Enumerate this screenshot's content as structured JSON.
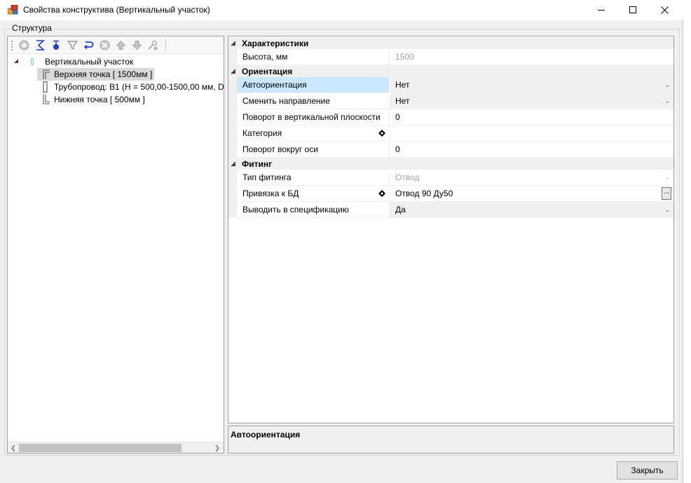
{
  "window": {
    "title": "Свойства конструктива (Вертикальный участок)"
  },
  "group": {
    "label": "Структура"
  },
  "toolbar": {
    "icons": [
      "add-circle-icon",
      "sigma-icon",
      "sort-icon",
      "filter-icon",
      "undo-arrow-icon",
      "remove-circle-icon",
      "move-up-icon",
      "move-down-icon",
      "tools-icon"
    ]
  },
  "tree": {
    "root": {
      "label": "Вертикальный участок",
      "expanded": true
    },
    "children": [
      {
        "label": "Верхняя точка [ 1500мм ]",
        "selected": true,
        "icon": "top-point-icon"
      },
      {
        "label": "Трубопровод: В1 (H = 500,00-1500,00 мм, D",
        "selected": false,
        "icon": "pipe-segment-icon"
      },
      {
        "label": "Нижняя точка [ 500мм ]",
        "selected": false,
        "icon": "bottom-point-icon"
      }
    ]
  },
  "properties": {
    "categories": [
      {
        "name": "Характеристики",
        "rows": [
          {
            "name": "Высота, мм",
            "value": "1500",
            "readonly": true
          }
        ]
      },
      {
        "name": "Ориентация",
        "rows": [
          {
            "name": "Автоориентация",
            "value": "Нет",
            "dropdown": true,
            "selected": true
          },
          {
            "name": "Сменить направление",
            "value": "Нет",
            "dropdown": true
          },
          {
            "name": "Поворот в вертикальной плоскости",
            "value": "0"
          },
          {
            "name": "Категория",
            "value": "",
            "marker": true
          },
          {
            "name": "Поворот вокруг оси",
            "value": "0"
          }
        ]
      },
      {
        "name": "Фитинг",
        "rows": [
          {
            "name": "Тип фитинга",
            "value": "Отвод",
            "readonly": true,
            "dropdown": true
          },
          {
            "name": "Привязка к БД",
            "value": "Отвод 90 Ду50",
            "marker": true,
            "ellipsis": true,
            "ellipsis_label": "..."
          },
          {
            "name": "Выводить в спецификацию",
            "value": "Да",
            "dropdown": true
          }
        ]
      }
    ]
  },
  "description": {
    "title": "Автоориентация"
  },
  "buttons": {
    "close_label": "Закрыть"
  },
  "colors": {
    "selection": "#cce8ff",
    "tree_selection": "#d9d9d9",
    "accent_blue": "#1f3fd1"
  }
}
